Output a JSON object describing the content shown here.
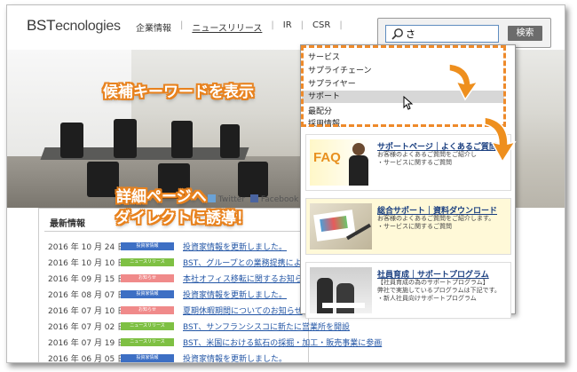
{
  "header": {
    "logo_big": "BST",
    "logo_small": "ecnologies",
    "nav": [
      "企業情報",
      "ニュースリリース",
      "IR",
      "CSR"
    ],
    "search_value": "さ",
    "search_button": "検索"
  },
  "suggestions": [
    "サービス",
    "サプライチェーン",
    "サプライヤー",
    "サポート",
    "最配分",
    "採用情報"
  ],
  "cards": [
    {
      "title": "サポートページ｜よくあるご質問",
      "desc1": "お客様のよくあるご質問をご紹介し",
      "desc2": "・サービスに関するご質問",
      "thumb_label": "FAQ"
    },
    {
      "title": "総合サポート｜資料ダウンロード",
      "desc1": "お客様のよくあるご質問をご紹介します。",
      "desc2": "・サービスに関するご質問"
    },
    {
      "title": "社員育成｜サポートプログラム",
      "desc1": "【社員育成の為のサポートプログラム】",
      "desc2": "弊社で実施しているプログラムは下記です。",
      "desc3": "・新人社員向けサポートプログラム"
    }
  ],
  "social": {
    "twitter": "Twitter",
    "facebook": "Facebook"
  },
  "news": {
    "title": "最新情報",
    "rows": [
      {
        "date": "2016 年 10 月 24 日",
        "tag": "投資家情報",
        "tag_color": "#3d6fc4",
        "text": "投資家情報を更新しました。"
      },
      {
        "date": "2016 年 10 月 10 日",
        "tag": "ニュースリリース",
        "tag_color": "#7ec043",
        "text": "BST、グループとの業務提携による"
      },
      {
        "date": "2016 年 09 月 15 日",
        "tag": "お知らせ",
        "tag_color": "#f08a8a",
        "text": "本社オフィス移転に関するお知らせ"
      },
      {
        "date": "2016 年 08 月 07 日",
        "tag": "投資家情報",
        "tag_color": "#3d6fc4",
        "text": "投資家情報を更新しました。"
      },
      {
        "date": "2016 年 07 月 10 日",
        "tag": "お知らせ",
        "tag_color": "#f08a8a",
        "text": "夏期休暇期間についてのお知らせ"
      },
      {
        "date": "2016 年 07 月 02 日",
        "tag": "ニュースリリース",
        "tag_color": "#7ec043",
        "text": "BST、サンフランシスコに新たに営業所を開設"
      },
      {
        "date": "2016 年 07 月 19 日",
        "tag": "ニュースリリース",
        "tag_color": "#7ec043",
        "text": "BST、米国における鉱石の採掘・加工・販売事業に参画"
      },
      {
        "date": "2016 年 06 月 05 日",
        "tag": "投資家情報",
        "tag_color": "#3d6fc4",
        "text": "投資家情報を更新しました。"
      }
    ]
  },
  "callouts": {
    "keyword": "候補キーワードを表示",
    "detail1": "詳細ページへ",
    "detail2": "ダイレクトに誘導！"
  },
  "colors": {
    "accent_orange": "#ee8a2a",
    "link_blue": "#2255a5"
  }
}
